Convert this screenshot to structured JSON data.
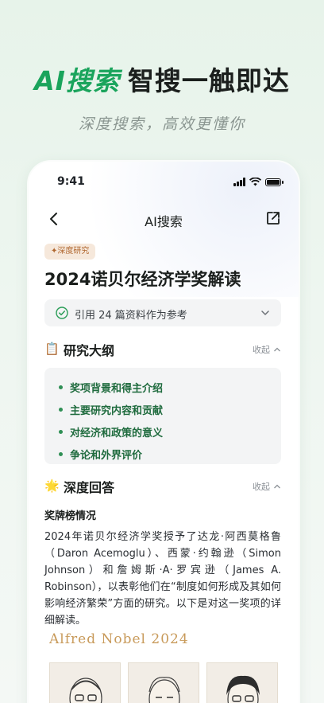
{
  "hero": {
    "title_accent": "AI搜索",
    "title_rest": "智搜一触即达",
    "subtitle": "深度搜索，高效更懂你"
  },
  "status_bar": {
    "time": "9:41"
  },
  "nav": {
    "title": "AI搜索"
  },
  "badge": "深度研究",
  "doc_title": "2024诺贝尔经济学奖解读",
  "reference": {
    "text": "引用 24 篇资料作为参考"
  },
  "outline": {
    "icon": "📋",
    "title": "研究大纲",
    "collapse_label": "收起",
    "items": [
      "奖项背景和得主介绍",
      "主要研究内容和贡献",
      "对经济和政策的意义",
      "争论和外界评价"
    ]
  },
  "answer": {
    "icon": "🌟",
    "title": "深度回答",
    "collapse_label": "收起",
    "sub_heading": "奖牌榜情况",
    "paragraph": "2024年诺贝尔经济学奖授予了达龙·阿西莫格鲁（Daron Acemoglu）、西蒙·约翰逊（Simon Johnson）和詹姆斯·A·罗宾逊（James A. Robinson），以表彰他们在“制度如何形成及其如何影响经济繁荣”方面的研究。以下是对这一奖项的详细解读。",
    "image_caption": "Alfred Nobel 2024"
  },
  "colors": {
    "accent_green": "#1aa45c",
    "outline_text": "#1f6b3e",
    "badge_bg": "#f6e8db",
    "badge_text": "#b0672f",
    "nobel_gold": "#c89a5a"
  }
}
